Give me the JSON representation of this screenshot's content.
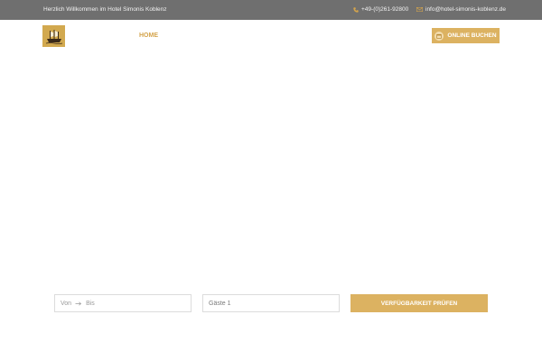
{
  "topbar": {
    "welcome": "Herzlich Willkommen im Hotel Simonis Koblenz",
    "phone": "+49-(0)261-92800",
    "email": "info@hotel-simonis-koblenz.de"
  },
  "header": {
    "nav_home": "HOME",
    "book_label": "ONLINE BUCHEN"
  },
  "booking": {
    "from_placeholder": "Von",
    "to_placeholder": "Bis",
    "guests_value": "Gäste 1",
    "check_label": "VERFÜGBARKEIT PRÜFEN"
  },
  "colors": {
    "topbar_bg": "#6f6f6f",
    "accent": "#dcb261",
    "nav_active": "#d4a44c"
  },
  "icons": {
    "phone": "phone-icon",
    "email": "envelope-icon",
    "book": "calendar-icon",
    "arrow": "arrow-right-icon",
    "logo": "ship-logo"
  }
}
